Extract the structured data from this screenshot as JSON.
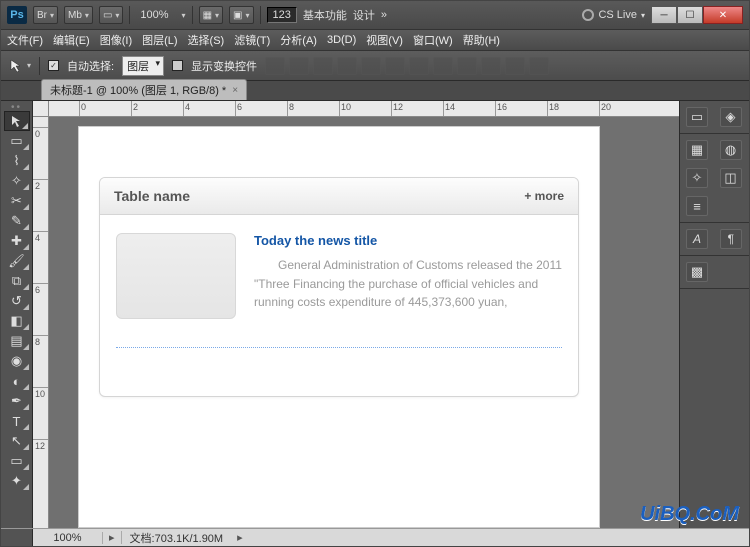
{
  "topbar": {
    "zoom": "100%",
    "badge_123": "123",
    "workspace_basic": "基本功能",
    "workspace_design": "设计",
    "more": "»",
    "cslive": "CS Live"
  },
  "menu": {
    "file": "文件(F)",
    "edit": "编辑(E)",
    "image": "图像(I)",
    "layer": "图层(L)",
    "select": "选择(S)",
    "filter": "滤镜(T)",
    "analysis": "分析(A)",
    "threeD": "3D(D)",
    "view": "视图(V)",
    "window": "窗口(W)",
    "help": "帮助(H)"
  },
  "options": {
    "auto_select_label": "自动选择:",
    "auto_select_value": "图层",
    "show_transform": "显示变换控件"
  },
  "tab": {
    "title": "未标题-1 @ 100% (图层 1, RGB/8) *"
  },
  "ruler": {
    "labels_h": [
      "0",
      "2",
      "4",
      "6",
      "8",
      "10",
      "12",
      "14",
      "16",
      "18",
      "20"
    ],
    "labels_v": [
      "0",
      "2",
      "4",
      "6",
      "8",
      "10",
      "12"
    ]
  },
  "card": {
    "header_title": "Table name",
    "header_more": "+ more",
    "news_title": "Today the news title",
    "news_body": "General Administration of Customs released the 2011 \"Three Financing the purchase of official vehicles and running costs expenditure of 445,373,600 yuan,"
  },
  "status": {
    "zoom": "100%",
    "doc_label": "文档:",
    "doc_value": "703.1K/1.90M"
  },
  "watermark": "UiBQ.CoM",
  "dock_labels": {
    "A": "A",
    "q": "¶"
  }
}
